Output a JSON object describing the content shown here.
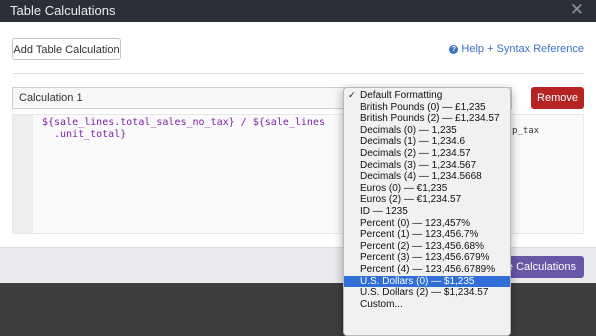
{
  "header": {
    "title": "Table Calculations",
    "close_glyph": "✕"
  },
  "toolbar": {
    "add_label": "Add Table Calculation",
    "help_icon": "?",
    "help_label": "Help + Syntax Reference"
  },
  "calculation": {
    "name": "Calculation 1",
    "remove_label": "Remove",
    "code_lines": [
      "${sale_lines.total_sales_no_tax} / ${sale_lines",
      ".unit_total}"
    ],
    "code_right": "p_tax"
  },
  "footer": {
    "save_label": "ble Calculations"
  },
  "format_dropdown": {
    "check_glyph": "✓",
    "options": [
      "Default Formatting",
      "British Pounds (0) — £1,235",
      "British Pounds (2) — £1,234.57",
      "Decimals (0) — 1,235",
      "Decimals (1) — 1,234.6",
      "Decimals (2) — 1,234.57",
      "Decimals (3) — 1,234.567",
      "Decimals (4) — 1,234.5668",
      "Euros (0) — €1,235",
      "Euros (2) — €1,234.57",
      "ID — 1235",
      "Percent (0) — 123,457%",
      "Percent (1) — 123,456.7%",
      "Percent (2) — 123,456.68%",
      "Percent (3) — 123,456.679%",
      "Percent (4) — 123,456.6789%",
      "U.S. Dollars (0) — $1,235",
      "U.S. Dollars (2) — $1,234.57",
      "Custom..."
    ],
    "highlighted": "U.S. Dollars (0) — $1,235"
  },
  "colors": {
    "header_bg": "#2a2f3a",
    "remove_button": "#b52323",
    "save_button": "#6957a8",
    "highlight": "#2f6fd6",
    "code_text": "#7d22a4",
    "help_link": "#3b74c2"
  }
}
